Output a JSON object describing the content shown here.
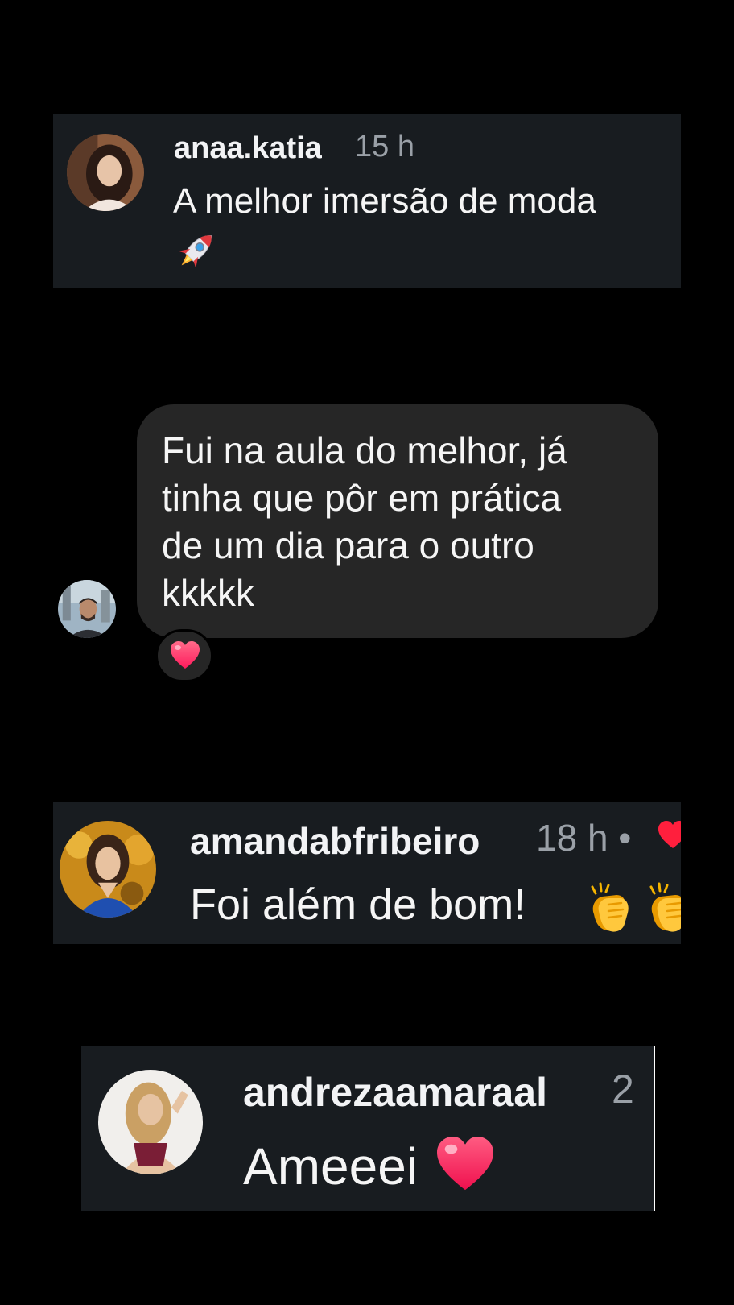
{
  "comments": [
    {
      "username": "anaa.katia",
      "time": "15 h",
      "text": "A melhor imersão de moda",
      "emoji": "rocket-icon"
    },
    {
      "username": "amandabfribeiro",
      "time": "18 h •",
      "text": "Foi além de bom!",
      "emojis": [
        "clapping-hands-icon",
        "clapping-hands-icon"
      ],
      "liked": true
    },
    {
      "username": "andrezaamaraal",
      "time": "2",
      "text": "Ameeei",
      "emoji": "red-heart-icon"
    }
  ],
  "dm": {
    "lines": [
      "Fui na aula do melhor, já",
      "tinha que pôr em prática",
      "de um dia para o outro",
      "kkkkk"
    ],
    "reaction": "heart-icon"
  },
  "colors": {
    "background": "#000000",
    "card": "#181c20",
    "bubble": "#262626",
    "heart": "#ff2d55",
    "time_text": "#9aa0a7"
  }
}
